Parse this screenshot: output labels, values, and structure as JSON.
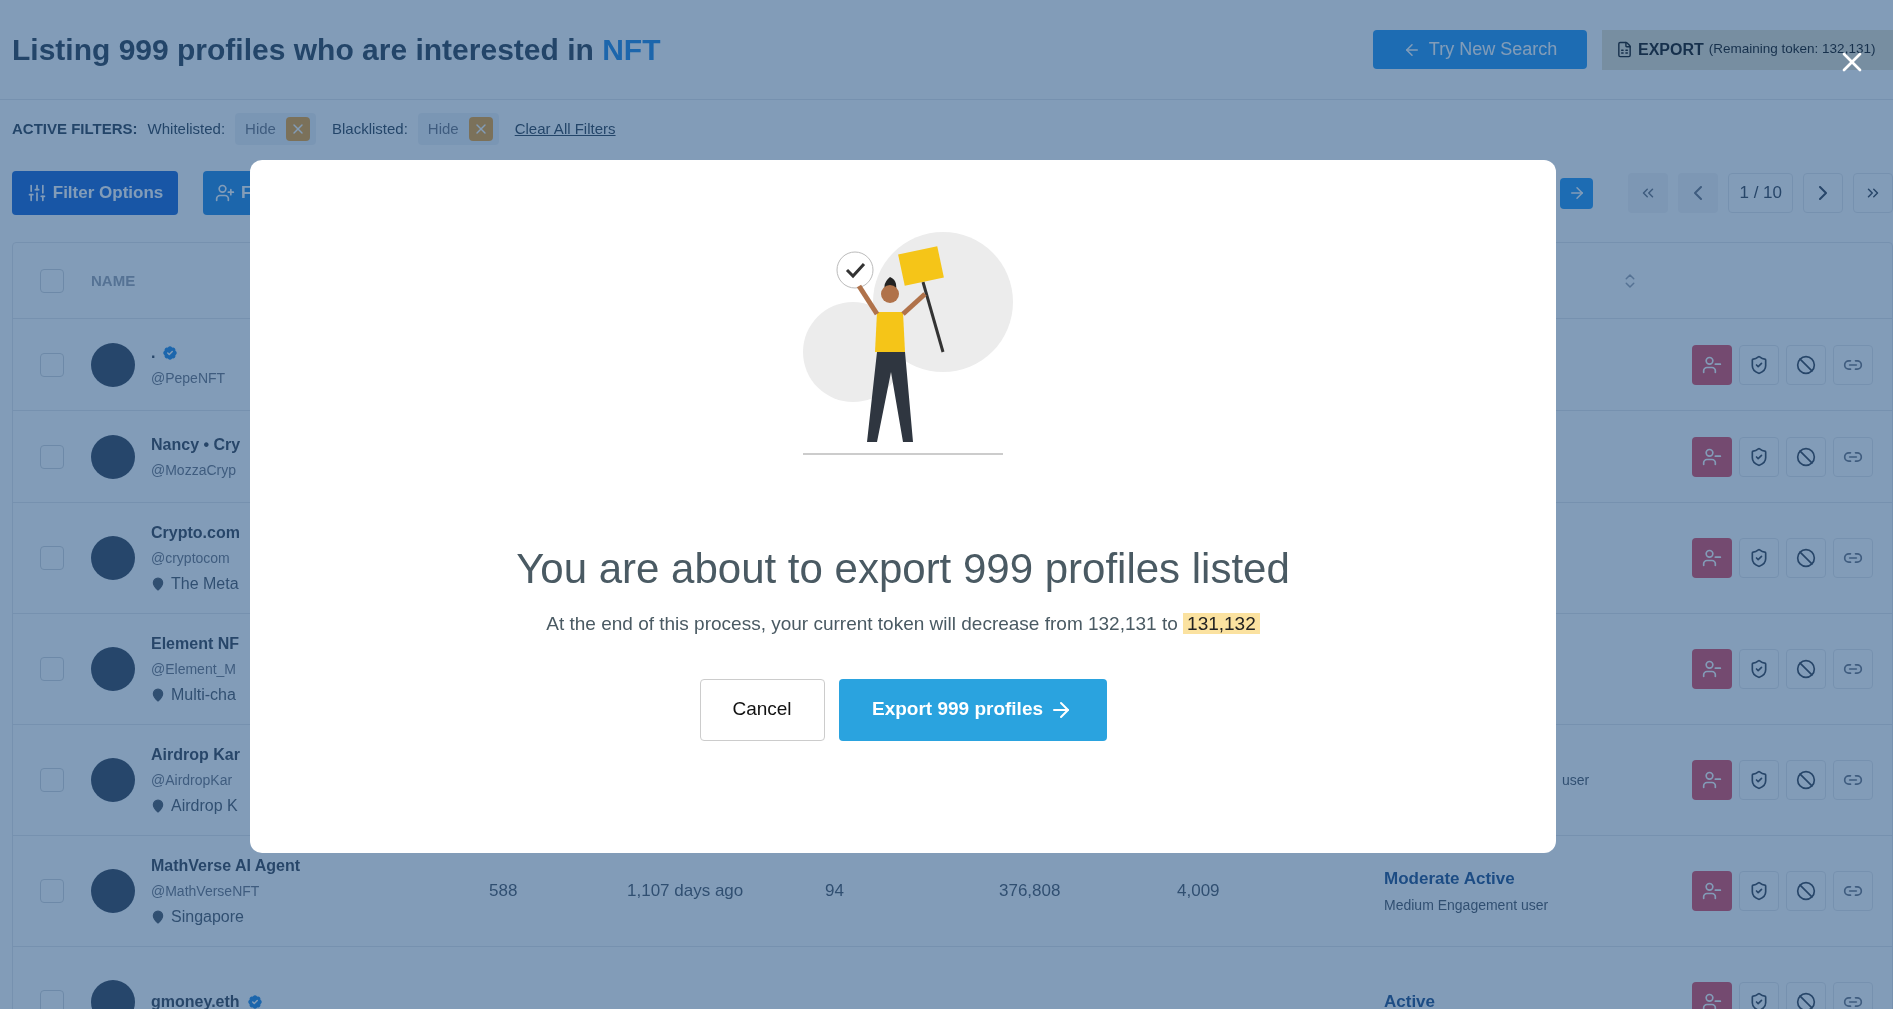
{
  "header": {
    "title_prefix": "Listing 999 profiles who are interested in",
    "title_keyword": "NFT",
    "try_new_search": "Try New Search",
    "export_label": "EXPORT",
    "export_note": "(Remaining token: 132,131)"
  },
  "filters": {
    "label": "ACTIVE FILTERS:",
    "items": [
      {
        "name": "Whitelisted:",
        "value": "Hide"
      },
      {
        "name": "Blacklisted:",
        "value": "Hide"
      }
    ],
    "clear": "Clear All Filters"
  },
  "toolbar": {
    "filter_button": "Filter Options",
    "second_button": "F"
  },
  "pagination": {
    "page": "1 / 10"
  },
  "table": {
    "columns": [
      "NAME"
    ],
    "header_checked": false,
    "rows": [
      {
        "checked": false,
        "name": ".",
        "verified": true,
        "handle": "@PepeNFT"
      },
      {
        "checked": false,
        "name": "Nancy • Cry",
        "handle": "@MozzaCryp"
      },
      {
        "checked": false,
        "name": "Crypto.com",
        "handle": "@cryptocom",
        "location": "The Meta"
      },
      {
        "checked": false,
        "name": "Element NF",
        "handle": "@Element_M",
        "location": "Multi-cha"
      },
      {
        "checked": false,
        "name": "Airdrop Kar",
        "handle": "@AirdropKar",
        "location": "Airdrop K",
        "status_note": "user"
      },
      {
        "checked": false,
        "name": "MathVerse AI Agent",
        "handle": "@MathVerseNFT",
        "location": "Singapore",
        "cells": [
          "588",
          "1,107 days ago",
          "94",
          "376,808",
          "4,009"
        ],
        "status": "Moderate Active",
        "status_note": "Medium Engagement user"
      },
      {
        "checked": false,
        "name": "gmoney.eth",
        "verified": true,
        "status": "Active"
      }
    ]
  },
  "modal": {
    "title": "You are about to export 999 profiles listed",
    "text": "At the end of this process, your current token will decrease from 132,131 to",
    "highlight": "131,132",
    "cancel": "Cancel",
    "confirm": "Export 999 profiles"
  }
}
